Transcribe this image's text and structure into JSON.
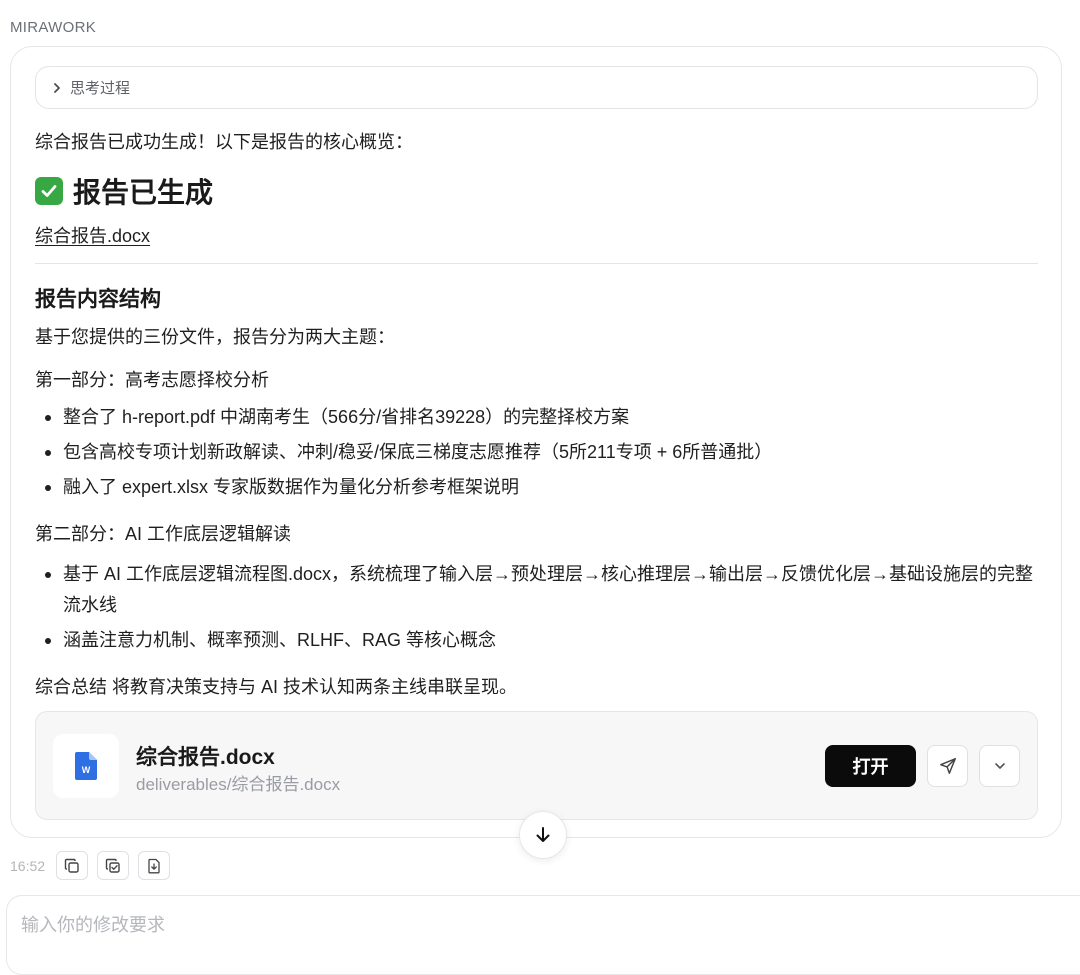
{
  "brand": "MIRAWORK",
  "message": {
    "thinking_label": "思考过程",
    "intro": "综合报告已成功生成！以下是报告的核心概览：",
    "title_emoji": "check-mark-icon",
    "title": "报告已生成",
    "doc_link": "综合报告.docx",
    "section_title": "报告内容结构",
    "para1": "基于您提供的三份文件，报告分为两大主题：",
    "part1_heading": "第一部分：高考志愿择校分析",
    "part1_bullets": [
      "整合了 h-report.pdf 中湖南考生（566分/省排名39228）的完整择校方案",
      "包含高校专项计划新政解读、冲刺/稳妥/保底三梯度志愿推荐（5所211专项 + 6所普通批）",
      "融入了 expert.xlsx 专家版数据作为量化分析参考框架说明"
    ],
    "part2_heading": "第二部分：AI 工作底层逻辑解读",
    "part2_bullets": [
      "基于 AI 工作底层逻辑流程图.docx，系统梳理了输入层→预处理层→核心推理层→输出层→反馈优化层→基础设施层的完整流水线",
      "涵盖注意力机制、概率预测、RLHF、RAG 等核心概念"
    ],
    "summary": "综合总结 将教育决策支持与 AI 技术认知两条主线串联呈现。"
  },
  "file_card": {
    "icon": "word-doc-icon",
    "name": "综合报告.docx",
    "path": "deliverables/综合报告.docx",
    "open_label": "打开"
  },
  "footer": {
    "time": "16:52",
    "input_placeholder": "输入你的修改要求"
  },
  "colors": {
    "accent": "#0b0b0c",
    "check_green": "#37a844",
    "word_blue": "#2f6fe4"
  }
}
